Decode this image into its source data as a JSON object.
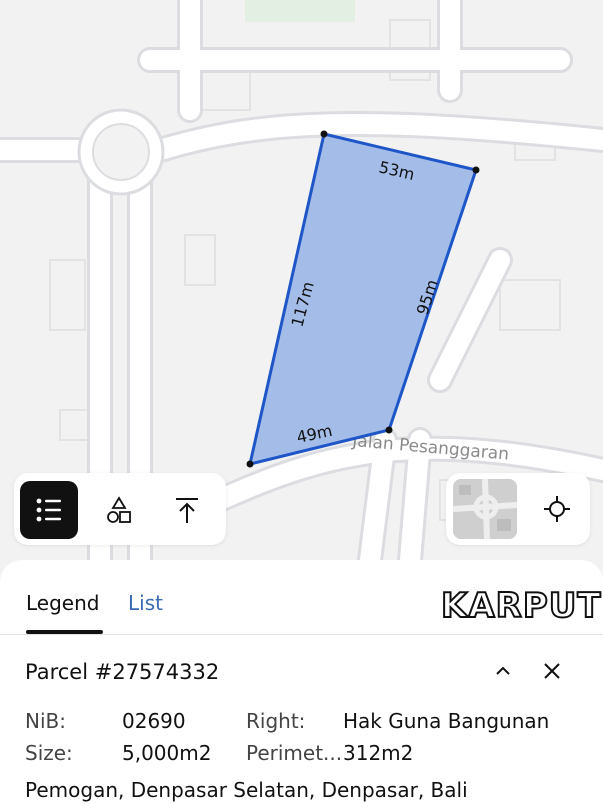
{
  "map": {
    "street_label": "Jalan Pesanggaran",
    "parcel_sides": [
      "53m",
      "95m",
      "49m",
      "117m"
    ],
    "parcel_fill": "#a4bde8",
    "parcel_stroke": "#1e56c8"
  },
  "toolbar": {
    "items": [
      {
        "icon": "legend-list-icon",
        "active": true
      },
      {
        "icon": "shapes-icon",
        "active": false
      },
      {
        "icon": "upload-arrow-icon",
        "active": false
      }
    ],
    "locate_icon": "crosshair-icon"
  },
  "sheet": {
    "tabs": [
      {
        "label": "Legend",
        "active": true
      },
      {
        "label": "List",
        "active": false
      }
    ],
    "brand": "KARPUT",
    "parcel": {
      "title": "Parcel #27574332",
      "nib_label": "NiB:",
      "nib_value": "02690",
      "right_label": "Right:",
      "right_value": "Hak Guna Bangunan",
      "size_label": "Size:",
      "size_value": "5,000m2",
      "perimeter_label": "Perimet...",
      "perimeter_value": "312m2",
      "address": "Pemogan, Denpasar Selatan, Denpasar, Bali"
    }
  }
}
